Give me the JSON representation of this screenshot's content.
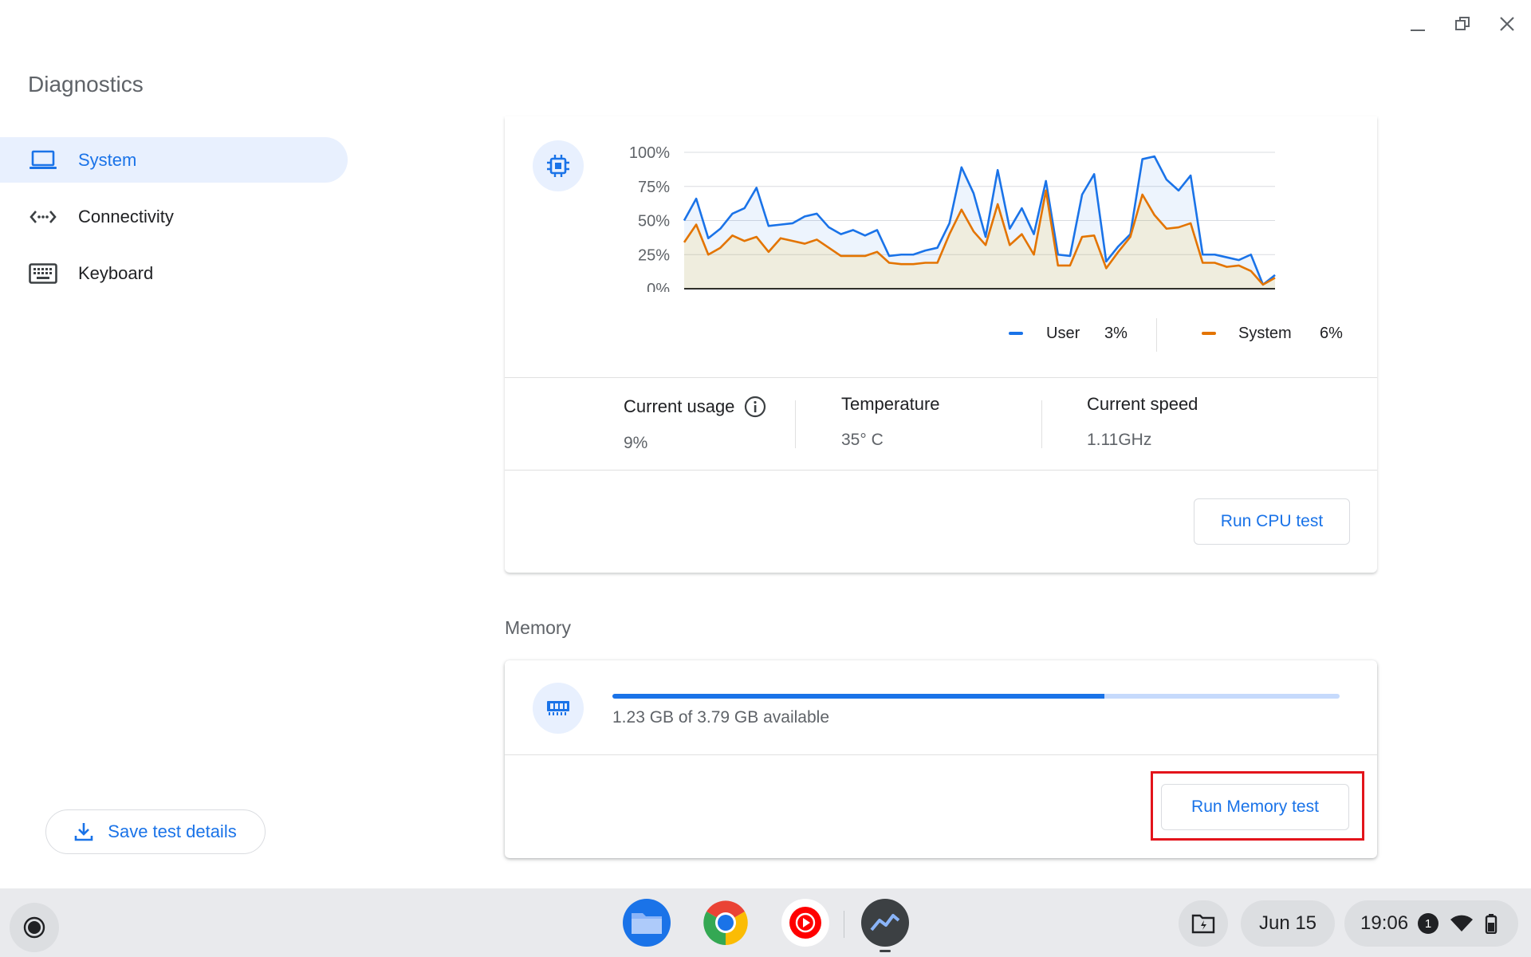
{
  "app": {
    "title": "Diagnostics"
  },
  "nav": {
    "items": [
      {
        "label": "System",
        "icon": "laptop-icon",
        "active": true
      },
      {
        "label": "Connectivity",
        "icon": "connectivity-icon",
        "active": false
      },
      {
        "label": "Keyboard",
        "icon": "keyboard-icon",
        "active": false
      }
    ]
  },
  "save_button": {
    "label": "Save test details"
  },
  "cpu": {
    "chart_data": {
      "type": "area",
      "yticks": [
        "100%",
        "75%",
        "50%",
        "25%",
        "0%"
      ],
      "ylim": [
        0,
        100
      ],
      "series": [
        {
          "name": "User",
          "color": "#1a73e8",
          "values": [
            50,
            66,
            37,
            44,
            55,
            59,
            74,
            46,
            47,
            48,
            53,
            55,
            45,
            40,
            43,
            39,
            43,
            24,
            25,
            25,
            28,
            30,
            48,
            89,
            70,
            38,
            87,
            44,
            59,
            40,
            79,
            25,
            24,
            69,
            84,
            20,
            31,
            40,
            95,
            97,
            80,
            72,
            83,
            25,
            25,
            23,
            21,
            25,
            3,
            10
          ]
        },
        {
          "name": "System",
          "color": "#e37400",
          "values": [
            34,
            47,
            25,
            30,
            39,
            35,
            38,
            27,
            37,
            35,
            33,
            36,
            30,
            24,
            24,
            24,
            27,
            19,
            18,
            18,
            19,
            19,
            40,
            58,
            42,
            32,
            62,
            32,
            40,
            25,
            72,
            17,
            17,
            38,
            39,
            15,
            27,
            38,
            69,
            54,
            44,
            45,
            48,
            19,
            19,
            16,
            17,
            13,
            3,
            8
          ]
        }
      ]
    },
    "legend": [
      {
        "name": "User",
        "value": "3%"
      },
      {
        "name": "System",
        "value": "6%"
      }
    ],
    "stats": {
      "usage_label": "Current usage",
      "usage_value": "9%",
      "temp_label": "Temperature",
      "temp_value": "35° C",
      "speed_label": "Current speed",
      "speed_value": "1.11GHz"
    },
    "run_button": "Run CPU test"
  },
  "memory": {
    "section_title": "Memory",
    "status_text": "1.23 GB of 3.79 GB available",
    "used_fraction": 0.676,
    "run_button": "Run Memory test"
  },
  "shelf": {
    "date": "Jun 15",
    "time": "19:06",
    "notification_count": "1",
    "apps": [
      "files-icon",
      "chrome-icon",
      "youtube-music-icon",
      "diagnostics-app-icon"
    ]
  }
}
